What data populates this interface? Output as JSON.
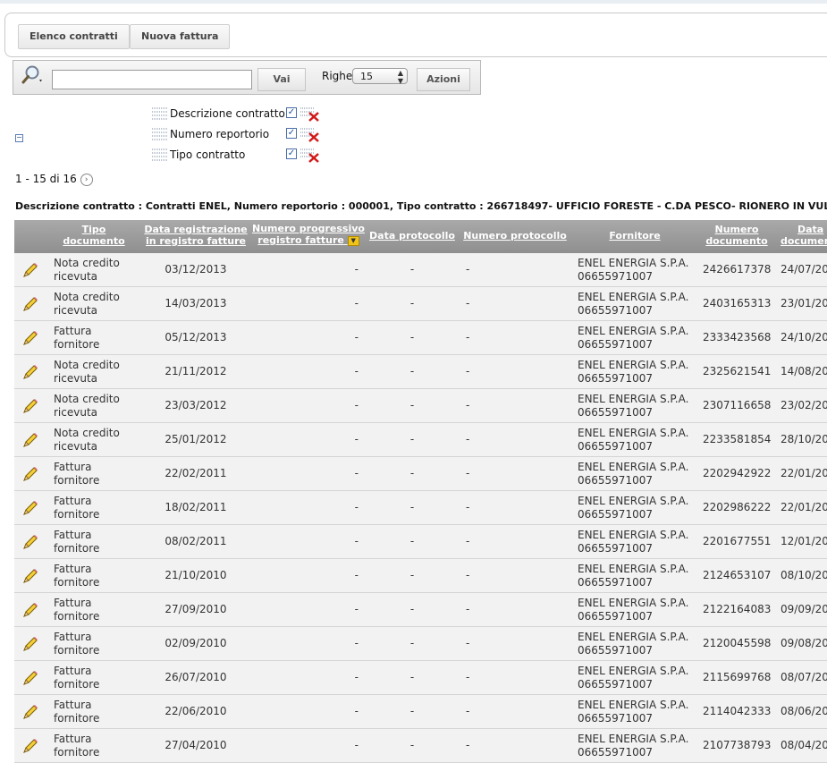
{
  "nav": {
    "elenco_label": "Elenco contratti",
    "nuova_label": "Nuova fattura"
  },
  "search": {
    "value": "",
    "vai_label": "Vai",
    "righe_label": "Righe",
    "righe_value": "15",
    "azioni_label": "Azioni"
  },
  "filters": [
    {
      "label": "Descrizione contratto"
    },
    {
      "label": "Numero reportorio"
    },
    {
      "label": "Tipo contratto"
    }
  ],
  "pager": {
    "text": "1 - 15 di 16"
  },
  "description": "Descrizione contratto : Contratti ENEL, Numero reportorio : 000001, Tipo contratto : 266718497- UFFICIO FORESTE - C.DA PESCO- RIONERO IN VULTURE",
  "table": {
    "headers": {
      "tipo_1": "Tipo",
      "tipo_2": "documento",
      "data_1": "Data registrazione",
      "data_2": "in registro fatture",
      "np_1": "Numero progressivo",
      "np_2": "registro fatture",
      "dp": "Data protocollo",
      "npr": "Numero protocollo",
      "forn": "Fornitore",
      "ndoc_1": "Numero",
      "ndoc_2": "documento",
      "ddoc_1": "Data",
      "ddoc_2": "documento"
    },
    "rows": [
      {
        "tipo_1": "Nota credito",
        "tipo_2": "ricevuta",
        "data": "03/12/2013",
        "np": "-",
        "dp": "-",
        "npr": "-",
        "forn_1": "ENEL ENERGIA S.P.A.",
        "forn_2": "06655971007",
        "ndoc": "2426617378",
        "ddoc": "24/07/20"
      },
      {
        "tipo_1": "Nota credito",
        "tipo_2": "ricevuta",
        "data": "14/03/2013",
        "np": "-",
        "dp": "-",
        "npr": "-",
        "forn_1": "ENEL ENERGIA S.P.A.",
        "forn_2": "06655971007",
        "ndoc": "2403165313",
        "ddoc": "23/01/20"
      },
      {
        "tipo_1": "Fattura",
        "tipo_2": "fornitore",
        "data": "05/12/2013",
        "np": "-",
        "dp": "-",
        "npr": "-",
        "forn_1": "ENEL ENERGIA S.P.A.",
        "forn_2": "06655971007",
        "ndoc": "2333423568",
        "ddoc": "24/10/20"
      },
      {
        "tipo_1": "Nota credito",
        "tipo_2": "ricevuta",
        "data": "21/11/2012",
        "np": "-",
        "dp": "-",
        "npr": "-",
        "forn_1": "ENEL ENERGIA S.P.A.",
        "forn_2": "06655971007",
        "ndoc": "2325621541",
        "ddoc": "14/08/20"
      },
      {
        "tipo_1": "Nota credito",
        "tipo_2": "ricevuta",
        "data": "23/03/2012",
        "np": "-",
        "dp": "-",
        "npr": "-",
        "forn_1": "ENEL ENERGIA S.P.A.",
        "forn_2": "06655971007",
        "ndoc": "2307116658",
        "ddoc": "23/02/20"
      },
      {
        "tipo_1": "Nota credito",
        "tipo_2": "ricevuta",
        "data": "25/01/2012",
        "np": "-",
        "dp": "-",
        "npr": "-",
        "forn_1": "ENEL ENERGIA S.P.A.",
        "forn_2": "06655971007",
        "ndoc": "2233581854",
        "ddoc": "28/10/20"
      },
      {
        "tipo_1": "Fattura",
        "tipo_2": "fornitore",
        "data": "22/02/2011",
        "np": "-",
        "dp": "-",
        "npr": "-",
        "forn_1": "ENEL ENERGIA S.P.A.",
        "forn_2": "06655971007",
        "ndoc": "2202942922",
        "ddoc": "22/01/20"
      },
      {
        "tipo_1": "Fattura",
        "tipo_2": "fornitore",
        "data": "18/02/2011",
        "np": "-",
        "dp": "-",
        "npr": "-",
        "forn_1": "ENEL ENERGIA S.P.A.",
        "forn_2": "06655971007",
        "ndoc": "2202986222",
        "ddoc": "22/01/20"
      },
      {
        "tipo_1": "Fattura",
        "tipo_2": "fornitore",
        "data": "08/02/2011",
        "np": "-",
        "dp": "-",
        "npr": "-",
        "forn_1": "ENEL ENERGIA S.P.A.",
        "forn_2": "06655971007",
        "ndoc": "2201677551",
        "ddoc": "12/01/20"
      },
      {
        "tipo_1": "Fattura",
        "tipo_2": "fornitore",
        "data": "21/10/2010",
        "np": "-",
        "dp": "-",
        "npr": "-",
        "forn_1": "ENEL ENERGIA S.P.A.",
        "forn_2": "06655971007",
        "ndoc": "2124653107",
        "ddoc": "08/10/20"
      },
      {
        "tipo_1": "Fattura",
        "tipo_2": "fornitore",
        "data": "27/09/2010",
        "np": "-",
        "dp": "-",
        "npr": "-",
        "forn_1": "ENEL ENERGIA S.P.A.",
        "forn_2": "06655971007",
        "ndoc": "2122164083",
        "ddoc": "09/09/20"
      },
      {
        "tipo_1": "Fattura",
        "tipo_2": "fornitore",
        "data": "02/09/2010",
        "np": "-",
        "dp": "-",
        "npr": "-",
        "forn_1": "ENEL ENERGIA S.P.A.",
        "forn_2": "06655971007",
        "ndoc": "2120045598",
        "ddoc": "09/08/20"
      },
      {
        "tipo_1": "Fattura",
        "tipo_2": "fornitore",
        "data": "26/07/2010",
        "np": "-",
        "dp": "-",
        "npr": "-",
        "forn_1": "ENEL ENERGIA S.P.A.",
        "forn_2": "06655971007",
        "ndoc": "2115699768",
        "ddoc": "08/07/20"
      },
      {
        "tipo_1": "Fattura",
        "tipo_2": "fornitore",
        "data": "22/06/2010",
        "np": "-",
        "dp": "-",
        "npr": "-",
        "forn_1": "ENEL ENERGIA S.P.A.",
        "forn_2": "06655971007",
        "ndoc": "2114042333",
        "ddoc": "08/06/20"
      },
      {
        "tipo_1": "Fattura",
        "tipo_2": "fornitore",
        "data": "27/04/2010",
        "np": "-",
        "dp": "-",
        "npr": "-",
        "forn_1": "ENEL ENERGIA S.P.A.",
        "forn_2": "06655971007",
        "ndoc": "2107738793",
        "ddoc": "08/04/20"
      }
    ]
  }
}
